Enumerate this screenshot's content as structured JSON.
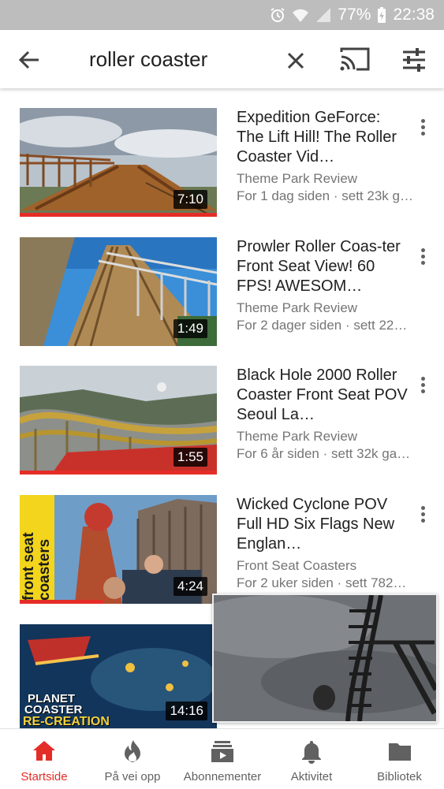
{
  "status_bar": {
    "battery": "77%",
    "time": "22:38",
    "icons": [
      "alarm-icon",
      "wifi-icon",
      "signal-icon",
      "battery-charging-icon"
    ]
  },
  "search": {
    "query": "roller coaster",
    "icons": [
      "back-arrow-icon",
      "clear-icon",
      "cast-icon",
      "filter-icon"
    ]
  },
  "results": [
    {
      "title": "Expedition GeForce: The Lift Hill! The Roller Coaster Vid…",
      "channel": "Theme Park Review",
      "stats": "For 1 dag siden · sett 23k g…",
      "duration": "7:10"
    },
    {
      "title": "Prowler Roller Coas-ter Front Seat View! 60 FPS! AWESOM…",
      "channel": "Theme Park Review",
      "stats": "For 2 dager siden · sett 22…",
      "duration": "1:49"
    },
    {
      "title": "Black Hole 2000 Roller Coaster Front Seat POV Seoul La…",
      "channel": "Theme Park Review",
      "stats": "For 6 år siden · sett 32k ga…",
      "duration": "1:55"
    },
    {
      "title": "Wicked Cyclone POV Full HD Six Flags New Englan…",
      "channel": "Front Seat Coasters",
      "stats": "For 2 uker siden · sett 782…",
      "duration": "4:24"
    },
    {
      "title": "",
      "channel": "",
      "stats": "",
      "duration": "14:16"
    }
  ],
  "thumbnail_text": {
    "t4_side": "front seat coasters",
    "t5_line1": "PLANET",
    "t5_line2": "COASTER",
    "t5_line3": "RE-CREATION"
  },
  "bottom_nav": [
    {
      "label": "Startside",
      "icon": "home-icon",
      "active": true
    },
    {
      "label": "På vei opp",
      "icon": "trending-icon",
      "active": false
    },
    {
      "label": "Abonnementer",
      "icon": "subscriptions-icon",
      "active": false
    },
    {
      "label": "Aktivitet",
      "icon": "bell-icon",
      "active": false
    },
    {
      "label": "Bibliotek",
      "icon": "folder-icon",
      "active": false
    }
  ],
  "colors": {
    "accent": "#e52d27",
    "status_bar": "#bdbdbd",
    "secondary_text": "#757575"
  }
}
